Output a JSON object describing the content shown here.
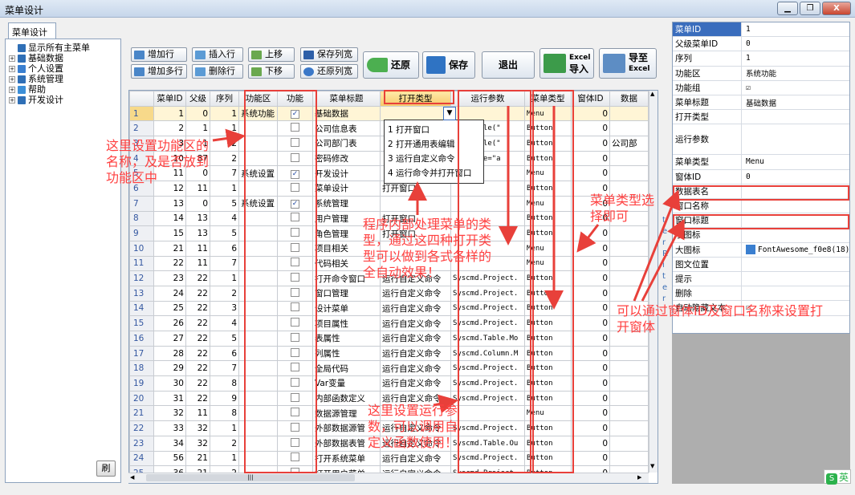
{
  "window": {
    "title": "菜单设计",
    "min": "▁",
    "max": "❐",
    "close": "X"
  },
  "tab": {
    "label": "菜单设计"
  },
  "tree": [
    {
      "label": "显示所有主菜单",
      "expander": "",
      "icon": "#2f6fb6"
    },
    {
      "label": "基础数据",
      "expander": "+",
      "icon": "#2f6fb6"
    },
    {
      "label": "个人设置",
      "expander": "+",
      "icon": "#3a7fd0"
    },
    {
      "label": "系统管理",
      "expander": "+",
      "icon": "#2f6fb6"
    },
    {
      "label": "帮助",
      "expander": "+",
      "icon": "#3c8fd8"
    },
    {
      "label": "开发设计",
      "expander": "+",
      "icon": "#2f6fb6"
    }
  ],
  "refresh_label": "刷",
  "toolbar": {
    "add_row": "增加行",
    "insert_row": "插入行",
    "move_up": "上移",
    "save_cols": "保存列宽",
    "add_rows": "增加多行",
    "delete_row": "删除行",
    "move_down": "下移",
    "restore_cols": "还原列宽",
    "restore": "还原",
    "save": "保存",
    "exit": "退出",
    "import_excel": "导入",
    "import_excel_tag": "Excel",
    "export_excel": "导至",
    "export_excel_tag": "Excel"
  },
  "grid": {
    "columns": [
      "",
      "菜单ID",
      "父级",
      "序列",
      "功能区",
      "功能",
      "菜单标题",
      "打开类型",
      "运行参数",
      "菜单类型",
      "窗体ID",
      "数据"
    ],
    "rows": [
      [
        "1",
        "1",
        "0",
        "1",
        "系统功能",
        "1",
        "基础数据",
        "",
        "",
        "Menu",
        "0",
        ""
      ],
      [
        "2",
        "2",
        "1",
        "1",
        "",
        "0",
        "公司信息表",
        "",
        "DataTable(\"",
        "Button",
        "0",
        ""
      ],
      [
        "3",
        "3",
        "1",
        "2",
        "",
        "0",
        "公司部门表",
        "",
        "DataTable(\"",
        "Button",
        "0",
        "公司部"
      ],
      [
        "4",
        "10",
        "87",
        "2",
        "",
        "0",
        "密码修改",
        "",
        "username=\"a",
        "Button",
        "0",
        ""
      ],
      [
        "5",
        "11",
        "0",
        "7",
        "系统设置",
        "1",
        "开发设计",
        "",
        "",
        "Menu",
        "0",
        ""
      ],
      [
        "6",
        "12",
        "11",
        "1",
        "",
        "0",
        "菜单设计",
        "打开窗口",
        "",
        "Button",
        "0",
        ""
      ],
      [
        "7",
        "13",
        "0",
        "5",
        "系统设置",
        "1",
        "系统管理",
        "",
        "",
        "Menu",
        "0",
        ""
      ],
      [
        "8",
        "14",
        "13",
        "4",
        "",
        "0",
        "用户管理",
        "打开窗口",
        "",
        "Button",
        "0",
        ""
      ],
      [
        "9",
        "15",
        "13",
        "5",
        "",
        "0",
        "角色管理",
        "打开窗口",
        "",
        "Button",
        "0",
        ""
      ],
      [
        "10",
        "21",
        "11",
        "6",
        "",
        "0",
        "项目相关",
        "",
        "",
        "Menu",
        "0",
        ""
      ],
      [
        "11",
        "22",
        "11",
        "7",
        "",
        "0",
        "代码相关",
        "",
        "",
        "Menu",
        "0",
        ""
      ],
      [
        "12",
        "23",
        "22",
        "1",
        "",
        "0",
        "打开命令窗口",
        "运行自定义命令",
        "Syscmd.Project.",
        "Button",
        "0",
        ""
      ],
      [
        "13",
        "24",
        "22",
        "2",
        "",
        "0",
        "窗口管理",
        "运行自定义命令",
        "Syscmd.Project.",
        "Button",
        "0",
        ""
      ],
      [
        "14",
        "25",
        "22",
        "3",
        "",
        "0",
        "设计菜单",
        "运行自定义命令",
        "Syscmd.Project.",
        "Button",
        "0",
        ""
      ],
      [
        "15",
        "26",
        "22",
        "4",
        "",
        "0",
        "项目属性",
        "运行自定义命令",
        "Syscmd.Project.",
        "Button",
        "0",
        ""
      ],
      [
        "16",
        "27",
        "22",
        "5",
        "",
        "0",
        "表属性",
        "运行自定义命令",
        "Syscmd.Table.Mo",
        "Button",
        "0",
        ""
      ],
      [
        "17",
        "28",
        "22",
        "6",
        "",
        "0",
        "列属性",
        "运行自定义命令",
        "Syscmd.Column.M",
        "Button",
        "0",
        ""
      ],
      [
        "18",
        "29",
        "22",
        "7",
        "",
        "0",
        "全局代码",
        "运行自定义命令",
        "Syscmd.Project.",
        "Button",
        "0",
        ""
      ],
      [
        "19",
        "30",
        "22",
        "8",
        "",
        "0",
        "Var变量",
        "运行自定义命令",
        "Syscmd.Project.",
        "Button",
        "0",
        ""
      ],
      [
        "20",
        "31",
        "22",
        "9",
        "",
        "0",
        "内部函数定义",
        "运行自定义命令",
        "Syscmd.Project.",
        "Button",
        "0",
        ""
      ],
      [
        "21",
        "32",
        "11",
        "8",
        "",
        "0",
        "数据源管理",
        "",
        "",
        "Menu",
        "0",
        ""
      ],
      [
        "22",
        "33",
        "32",
        "1",
        "",
        "0",
        "外部数据源管",
        "运行自定义命令",
        "Syscmd.Project.",
        "Button",
        "0",
        ""
      ],
      [
        "23",
        "34",
        "32",
        "2",
        "",
        "0",
        "外部数据表管",
        "运行自定义命令",
        "Syscmd.Table.Ou",
        "Button",
        "0",
        ""
      ],
      [
        "24",
        "56",
        "21",
        "1",
        "",
        "0",
        "打开系统菜单",
        "运行自定义命令",
        "Syscmd.Project.",
        "Button",
        "0",
        ""
      ],
      [
        "25",
        "36",
        "21",
        "2",
        "",
        "0",
        "打开用户菜单",
        "运行自定义命令",
        "Syscmd.Project.",
        "Button",
        "0",
        ""
      ]
    ]
  },
  "dropdown": [
    "1 打开窗口",
    "2 打开通用表编辑",
    "3 运行自定义命令",
    "4 运行命令并打开窗口"
  ],
  "scroll": {
    "up": "▲",
    "down": "▼",
    "left": "◀",
    "right": "▶",
    "thumb": "|||"
  },
  "properties": [
    {
      "k": "菜单ID",
      "v": "1"
    },
    {
      "k": "父级菜单ID",
      "v": "0"
    },
    {
      "k": "序列",
      "v": "1"
    },
    {
      "k": "功能区",
      "v": "系统功能"
    },
    {
      "k": "功能组",
      "v": "☑"
    },
    {
      "k": "菜单标题",
      "v": "基础数据"
    },
    {
      "k": "打开类型",
      "v": ""
    },
    {
      "k": "运行参数",
      "v": ""
    },
    {
      "k": "菜单类型",
      "v": "Menu"
    },
    {
      "k": "窗体ID",
      "v": "0"
    },
    {
      "k": "数据表名",
      "v": ""
    },
    {
      "k": "窗口名称",
      "v": ""
    },
    {
      "k": "窗口标题",
      "v": ""
    },
    {
      "k": "小图标",
      "v": ""
    },
    {
      "k": "大图标",
      "v": "FontAwesome_f0e8(18)"
    },
    {
      "k": "图文位置",
      "v": ""
    },
    {
      "k": "提示",
      "v": ""
    },
    {
      "k": "删除",
      "v": ""
    },
    {
      "k": "自动隐藏文本",
      "v": "☐"
    }
  ],
  "annotations": {
    "func_area": "这里设置功能区的名称，及是否放到功能区中",
    "open_type": "程序内部处理菜单的类型，通过这四种打开类型可以做到各式各样的全自动效果！",
    "menu_type": "菜单类型选择即可",
    "run_param": "这里设置运行参数，可以调用自定义函数使用！",
    "window_id": "可以通过窗体ID及窗口名称来设置打开窗体"
  },
  "vertical_text": "t e r R i t e r",
  "ime_badge": "英"
}
